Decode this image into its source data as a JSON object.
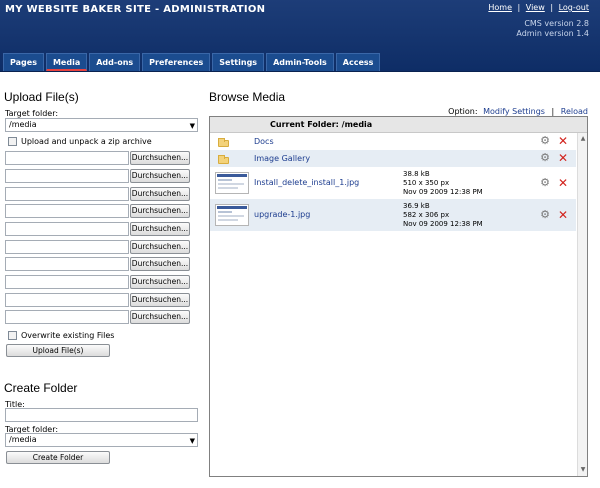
{
  "header": {
    "title": "MY WEBSITE BAKER SITE - ADMINISTRATION",
    "links": {
      "home": "Home",
      "view": "View",
      "logout": "Log-out",
      "sep": "|"
    },
    "cms_version": "CMS version 2.8",
    "admin_version": "Admin version 1.4"
  },
  "tabs": [
    "Pages",
    "Media",
    "Add-ons",
    "Preferences",
    "Settings",
    "Admin-Tools",
    "Access"
  ],
  "upload": {
    "heading": "Upload File(s)",
    "target_label": "Target folder:",
    "target_value": "/media",
    "unzip_label": "Upload and unpack a zip archive",
    "browse_label": "Durchsuchen...",
    "overwrite_label": "Overwrite existing Files",
    "submit_label": "Upload File(s)"
  },
  "create_folder": {
    "heading": "Create Folder",
    "title_label": "Title:",
    "target_label": "Target folder:",
    "target_value": "/media",
    "submit_label": "Create Folder"
  },
  "browse": {
    "heading": "Browse Media",
    "option_label": "Option:",
    "modify_settings": "Modify Settings",
    "sep": "|",
    "reload": "Reload",
    "current_folder": "Current Folder: /media",
    "items": [
      {
        "name": "Docs",
        "kind": "folder"
      },
      {
        "name": "Image Gallery",
        "kind": "folder"
      },
      {
        "name": "Install_delete_install_1.jpg",
        "kind": "image",
        "size": "38.8 kB",
        "dims": "510 x 350 px",
        "date": "Nov 09 2009 12:38 PM"
      },
      {
        "name": "upgrade-1.jpg",
        "kind": "image",
        "size": "36.9 kB",
        "dims": "582 x 306 px",
        "date": "Nov 09 2009 12:38 PM"
      }
    ]
  },
  "colors": {
    "header_bg": "#0e2d66",
    "tab_bg": "#1b4c8f",
    "active_tab_underline": "#e8423f",
    "link": "#1d3d8f",
    "delete": "#d2231d"
  },
  "icons": {
    "folder": "folder-icon",
    "settings": "gear-icon",
    "delete": "delete-icon"
  }
}
